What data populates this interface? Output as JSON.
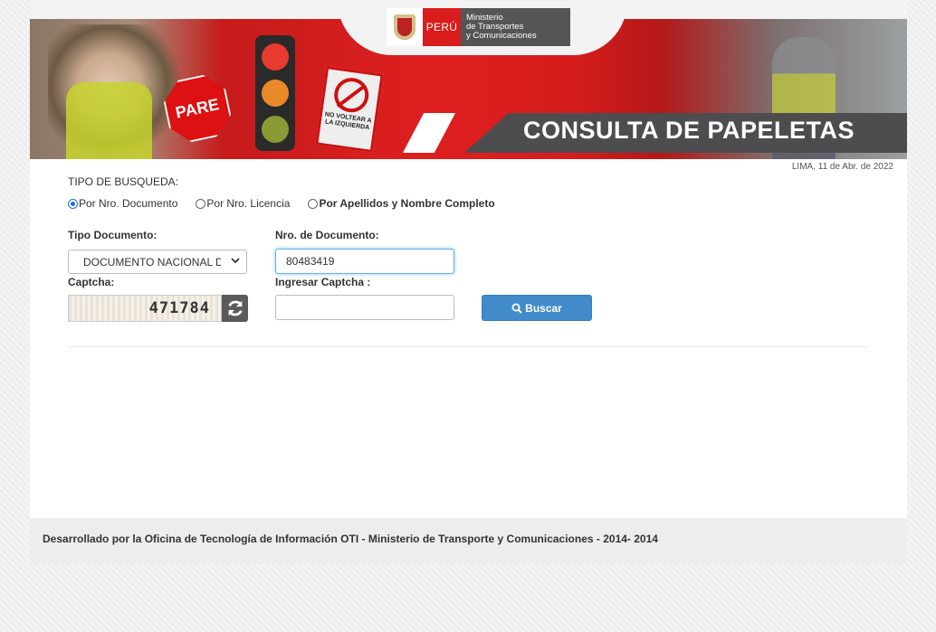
{
  "header": {
    "logo_peru": "PERÚ",
    "logo_ministry_line1": "Ministerio",
    "logo_ministry_line2": "de Transportes",
    "logo_ministry_line3": "y Comunicaciones",
    "banner_title": "CONSULTA DE PAPELETAS",
    "sign_pare": "PARE",
    "sign_no_turn": "NO VOLTEAR A LA IZQUIERDA"
  },
  "date_text": "LIMA, 11 de Abr. de 2022",
  "search": {
    "type_label": "TIPO DE BUSQUEDA:",
    "options": [
      {
        "label": "Por Nro. Documento",
        "selected": true
      },
      {
        "label": "Por Nro. Licencia",
        "selected": false
      },
      {
        "label": "Por Apellidos y Nombre Completo",
        "selected": false
      }
    ],
    "doc_type_label": "Tipo Documento:",
    "doc_type_value": "DOCUMENTO NACIONAL DE IDENTIDAD",
    "doc_number_label": "Nro. de Documento:",
    "doc_number_value": "80483419",
    "captcha_label": "Captcha:",
    "captcha_text": "471784",
    "captcha_input_label": "Ingresar Captcha :",
    "captcha_input_value": "",
    "search_button": "Buscar"
  },
  "footer_text": "Desarrollado por la Oficina de Tecnología de Información OTI - Ministerio de Transporte y Comunicaciones - 2014- 2014",
  "colors": {
    "brand_red": "#d91c1c",
    "button_blue": "#428bca",
    "title_band": "#4d4d4f"
  }
}
